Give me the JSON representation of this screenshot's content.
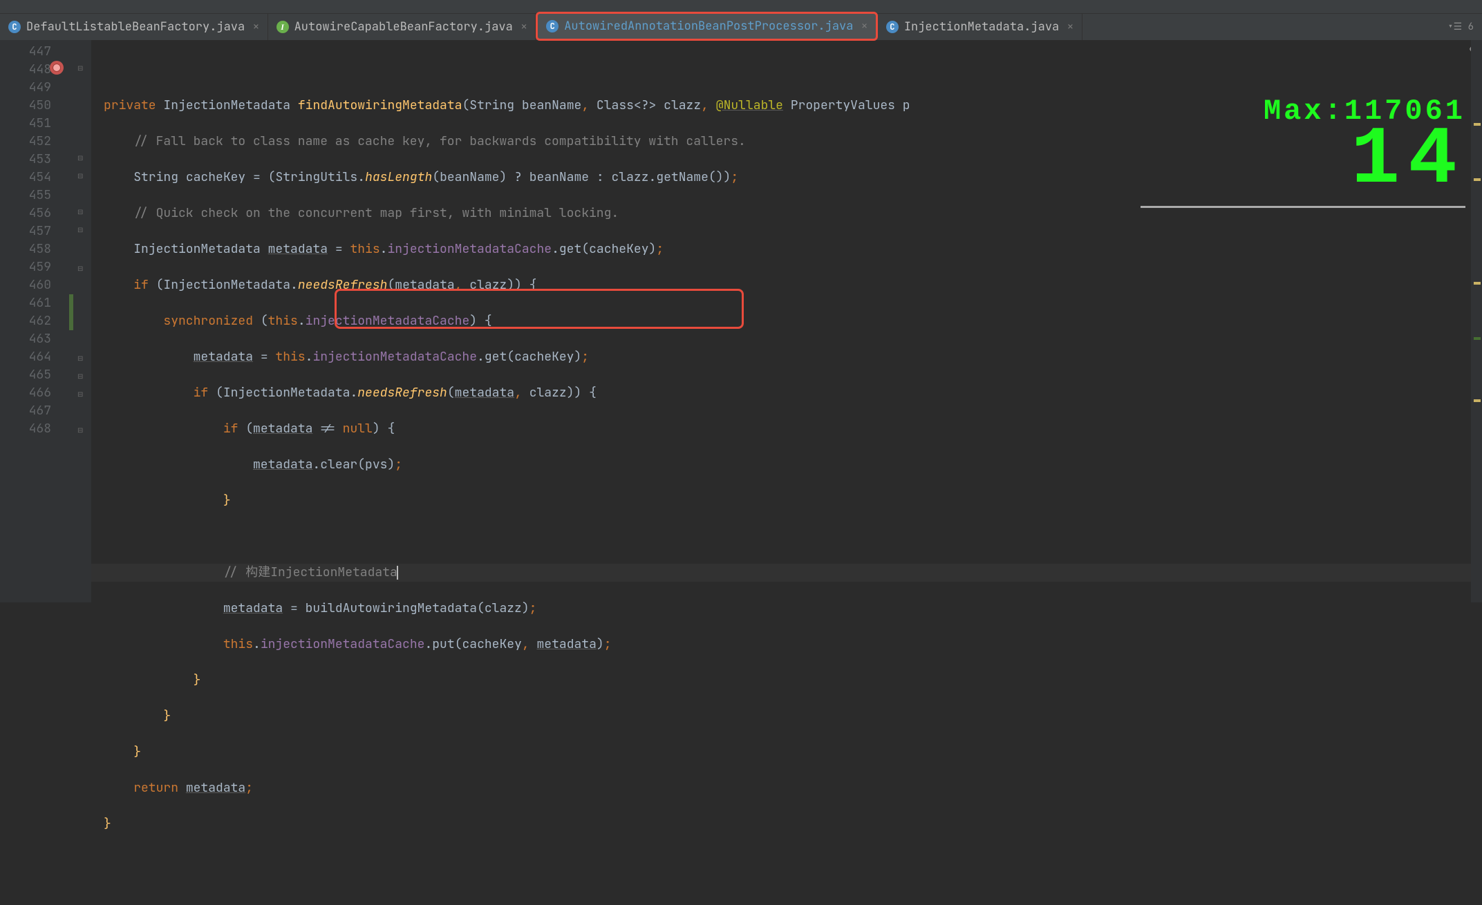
{
  "tabs": {
    "t0": {
      "label": "DefaultListableBeanFactory.java",
      "icon": "C"
    },
    "t1": {
      "label": "AutowireCapableBeanFactory.java",
      "icon": "I"
    },
    "t2": {
      "label": "AutowiredAnnotationBeanPostProcessor.java",
      "icon": "C"
    },
    "t3": {
      "label": "InjectionMetadata.java",
      "icon": "C"
    },
    "right_indicator": "▾☰ 6"
  },
  "line_numbers": [
    "447",
    "448",
    "449",
    "450",
    "451",
    "452",
    "453",
    "454",
    "455",
    "456",
    "457",
    "458",
    "459",
    "460",
    "461",
    "462",
    "463",
    "464",
    "465",
    "466",
    "467",
    "468"
  ],
  "overlay": {
    "top": "Max:117061",
    "big": "14"
  },
  "code": {
    "kw_private": "private",
    "type_im": "InjectionMetadata",
    "m_find": "findAutowiringMetadata",
    "t_string": "String",
    "p_beanName": "beanName",
    "t_class": "Class",
    "generic": "<?>",
    "p_clazz": "clazz",
    "ann_nullable": "@Nullable",
    "t_pv": "PropertyValues",
    "p_pvs": "p",
    "cmt_fallback": "// Fall back to class name as cache key, for backwards compatibility with",
    "cmt_fallback_tail": " callers.",
    "v_cachekey": "cacheKey",
    "t_stringutils": "StringUtils",
    "m_haslen": "hasLength",
    "m_getname": "getName",
    "cmt_quick": "// Quick check on the concurrent map first, with minimal locking.",
    "v_metadata": "metadata",
    "kw_this": "this",
    "f_cache": "injectionMetadataCache",
    "m_get": "get",
    "kw_if": "if",
    "m_needsrefresh": "needsRefresh",
    "kw_sync": "synchronized",
    "kw_null": "null",
    "m_clear": "clear",
    "p_pvs_full": "pvs",
    "cmt_build": "// 构建InjectionMetadata",
    "m_build": "buildAutowiringMetadata",
    "m_put": "put",
    "kw_return": "return"
  }
}
